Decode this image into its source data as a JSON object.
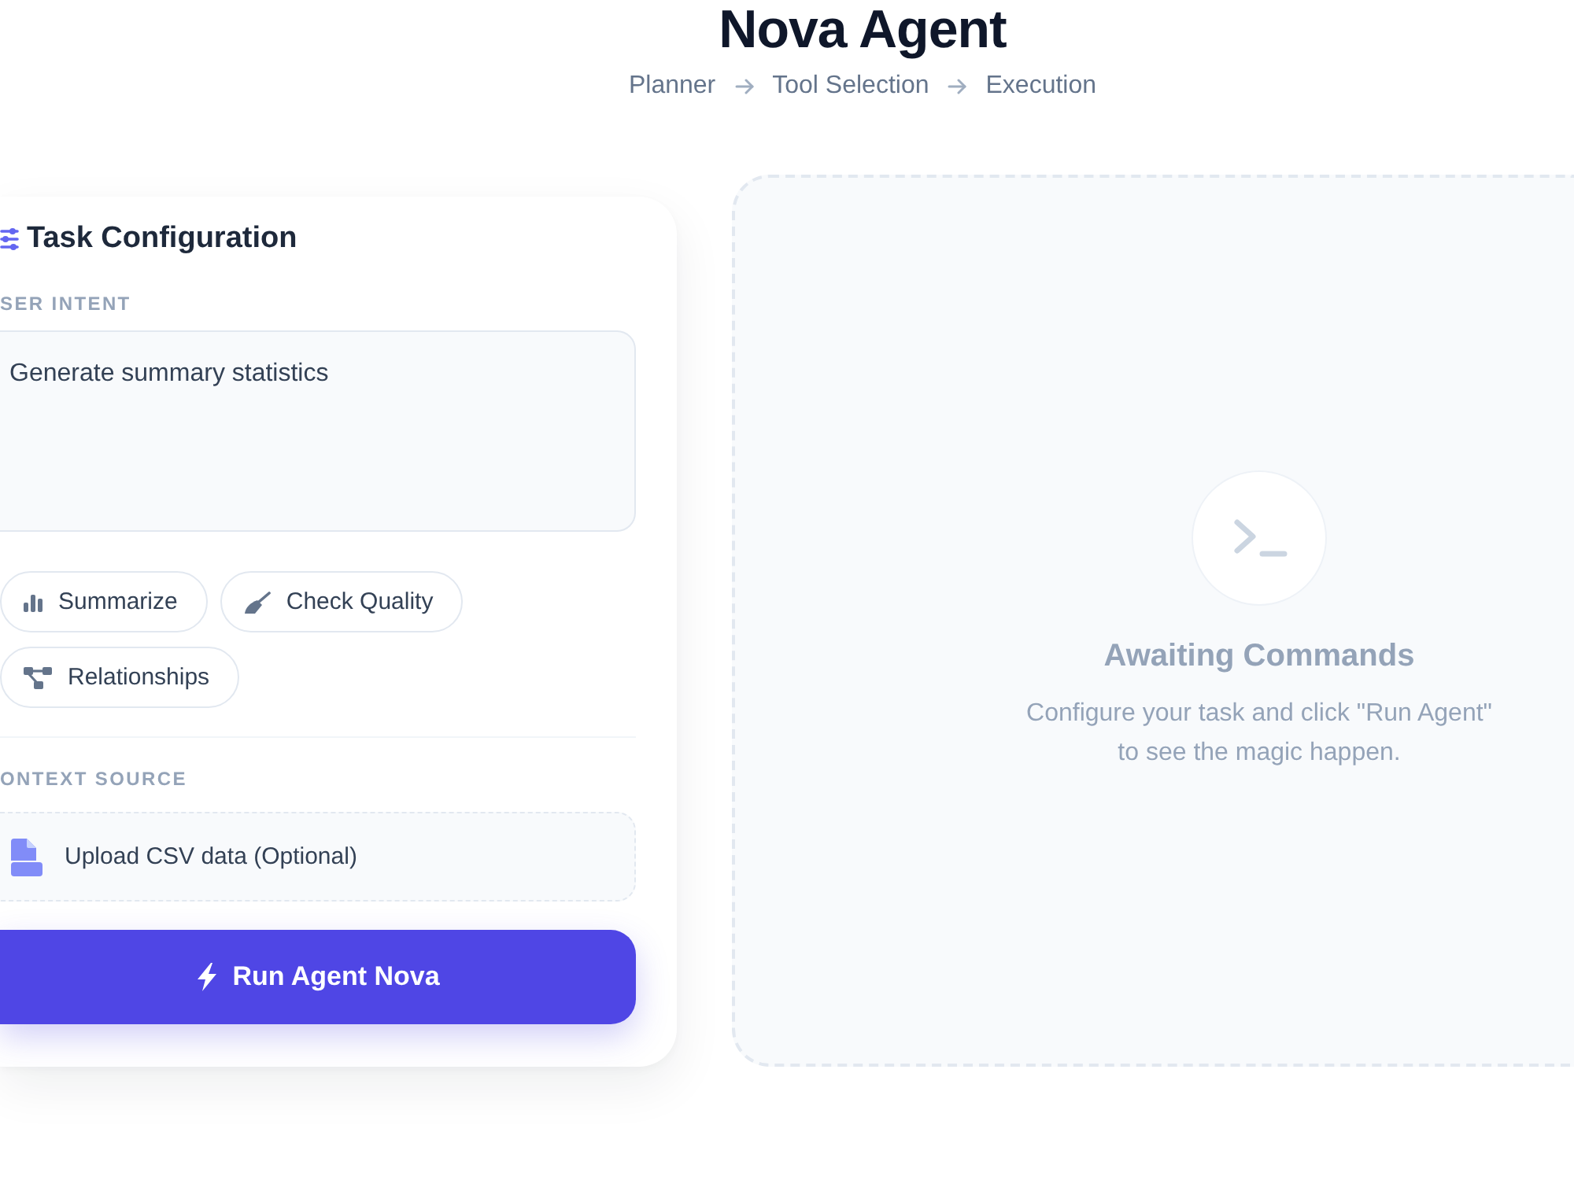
{
  "header": {
    "title": "Nova Agent",
    "steps": [
      "Planner",
      "Tool Selection",
      "Execution"
    ]
  },
  "config_panel": {
    "title": "Task Configuration",
    "intent_label": "SER INTENT",
    "intent_value": "Generate summary statistics",
    "quick_actions": [
      {
        "label": "Summarize",
        "kind": "stats"
      },
      {
        "label": "Check Quality",
        "kind": "quality"
      },
      {
        "label": "Relationships",
        "kind": "graph"
      }
    ],
    "context_label": "ONTEXT SOURCE",
    "upload_label": "Upload CSV data (Optional)",
    "run_button": "Run Agent Nova"
  },
  "output_panel": {
    "title": "Awaiting Commands",
    "message": "Configure your task and click \"Run Agent\" to see the magic happen."
  }
}
